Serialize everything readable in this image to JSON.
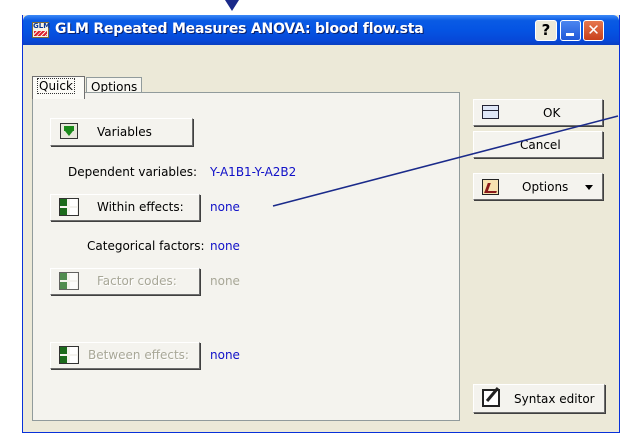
{
  "window": {
    "title": "GLM Repeated Measures ANOVA: blood flow.sta",
    "app_icon_text": "GLM",
    "help_label": "?"
  },
  "tabs": [
    {
      "label": "Quick"
    },
    {
      "label": "Options"
    }
  ],
  "quick": {
    "variables_button": "Variables",
    "dependent_label": "Dependent variables:",
    "dependent_value": "Y-A1B1-Y-A2B2",
    "within_button": "Within effects:",
    "within_value": "none",
    "categorical_label": "Categorical factors:",
    "categorical_value": "none",
    "factor_codes_button": "Factor codes:",
    "factor_codes_value": "none",
    "between_button": "Between effects:",
    "between_value": "none"
  },
  "side": {
    "ok_label": "OK",
    "cancel_label": "Cancel",
    "options_label": "Options",
    "syntax_label": "Syntax editor"
  },
  "colors": {
    "value_text": "#1010c8",
    "title_bar": "#0554e3"
  }
}
